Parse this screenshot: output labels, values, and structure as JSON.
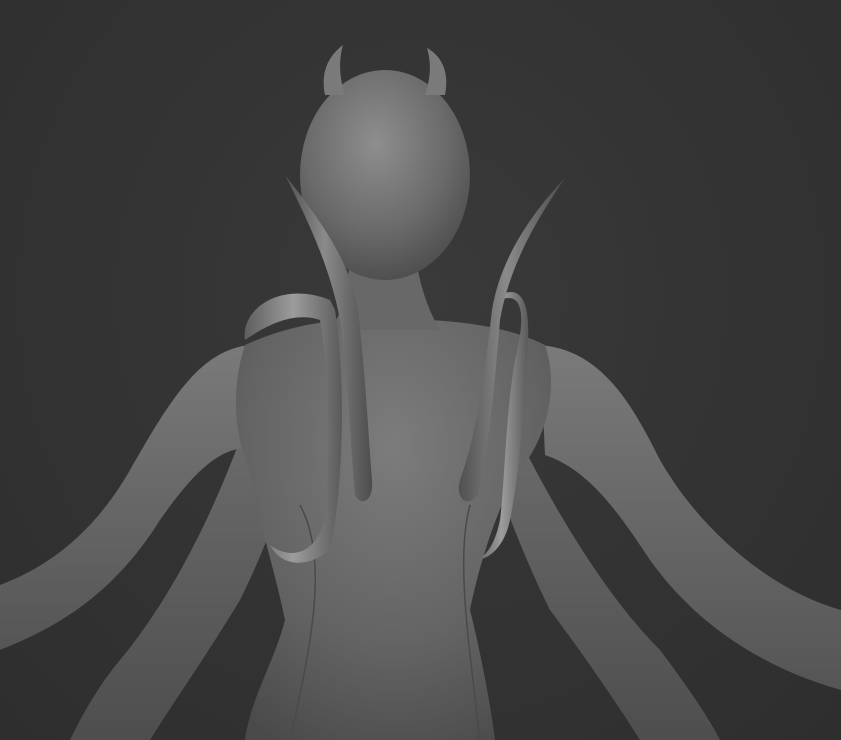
{
  "scene": {
    "background_color": "#333333",
    "model_base_color": "#6e6e6e",
    "highlight_color": "#9a9a9a",
    "shadow_color": "#3e3e3e",
    "parts": [
      "head",
      "horns",
      "neck",
      "torso",
      "upper-arms",
      "lower-arms",
      "back-tentacles",
      "back-straps"
    ]
  }
}
